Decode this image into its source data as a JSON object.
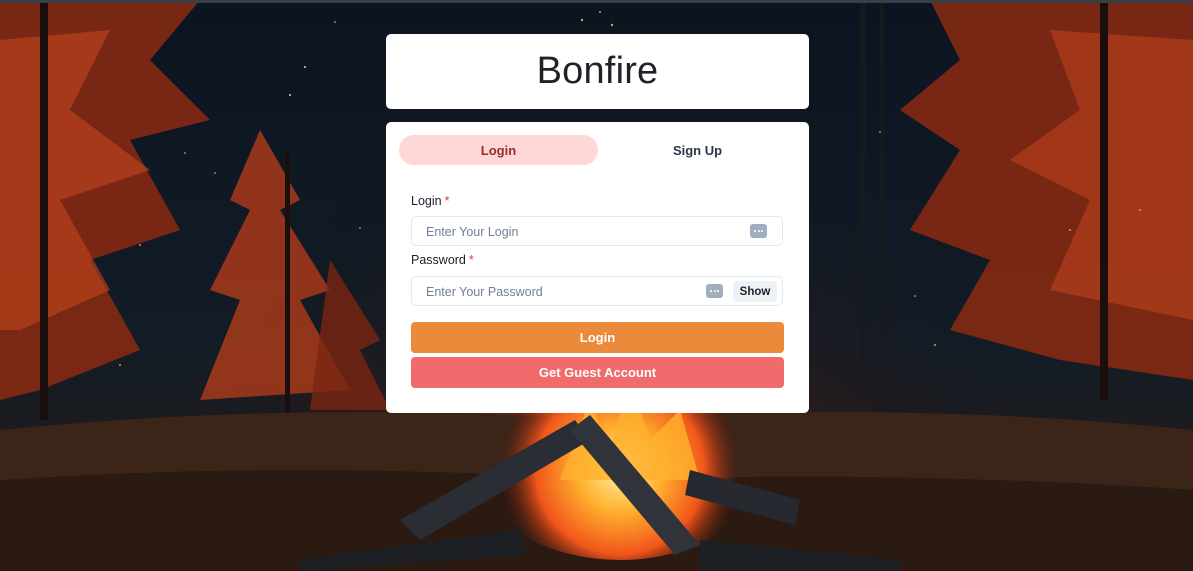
{
  "app": {
    "title": "Bonfire"
  },
  "tabs": [
    {
      "label": "Login",
      "active": true
    },
    {
      "label": "Sign Up",
      "active": false
    }
  ],
  "form": {
    "login": {
      "label": "Login",
      "required_mark": "*",
      "placeholder": "Enter Your Login",
      "value": ""
    },
    "password": {
      "label": "Password",
      "required_mark": "*",
      "placeholder": "Enter Your Password",
      "value": "",
      "show_label": "Show"
    },
    "submit_label": "Login",
    "guest_label": "Get Guest Account"
  },
  "icons": {
    "login_field_icon": "password-manager-icon",
    "password_field_icon": "password-manager-icon"
  },
  "colors": {
    "active_tab_bg": "#fed7d7",
    "active_tab_text": "#9b2c2c",
    "login_button": "#ea8a3a",
    "guest_button": "#f06b6b",
    "required": "#e53e3e"
  }
}
